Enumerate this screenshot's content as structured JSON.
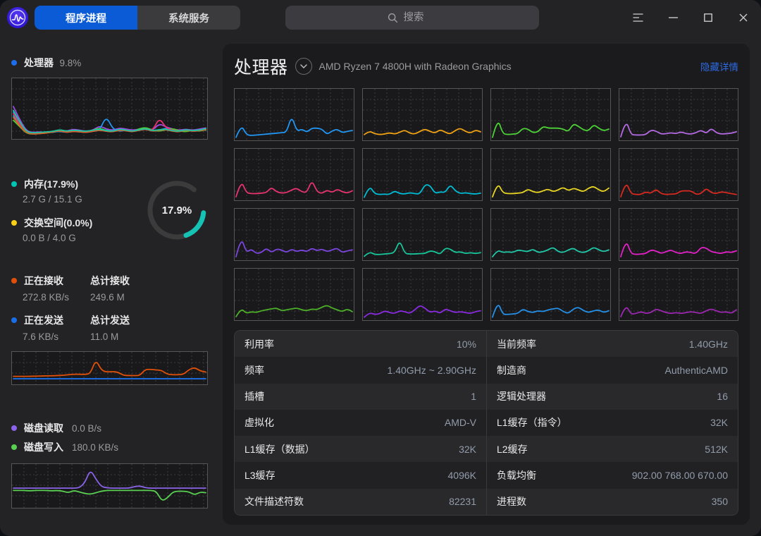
{
  "titlebar": {
    "tabs": [
      {
        "label": "程序进程",
        "active": true
      },
      {
        "label": "系统服务",
        "active": false
      }
    ],
    "search_placeholder": "搜索"
  },
  "colors": {
    "accent_blue": "#2e6be6",
    "active_tab": "#0b5bd7",
    "ring_used": "#16c2b4",
    "ring_track": "#3b3b3b"
  },
  "sidebar": {
    "cpu": {
      "label": "处理器",
      "value": "9.8%",
      "bullet": "#1e6eeb"
    },
    "memory": {
      "label": "内存(17.9%)",
      "value": "2.7 G / 15.1 G",
      "bullet": "#00c5b5"
    },
    "swap": {
      "label": "交换空间(0.0%)",
      "value": "0.0 B / 4.0 G",
      "bullet": "#f8d015"
    },
    "memory_ring": {
      "percent": 17.9,
      "label": "17.9%"
    },
    "net_recv": {
      "label": "正在接收",
      "value": "272.8 KB/s",
      "bullet": "#e0500a"
    },
    "net_recv_total": {
      "label": "总计接收",
      "value": "249.6 M"
    },
    "net_send": {
      "label": "正在发送",
      "value": "7.6 KB/s",
      "bullet": "#1a6ee8"
    },
    "net_send_total": {
      "label": "总计发送",
      "value": "11.0 M"
    },
    "disk_read": {
      "label": "磁盘读取",
      "value": "0.0 B/s",
      "bullet": "#8a64e8"
    },
    "disk_write": {
      "label": "磁盘写入",
      "value": "180.0 KB/s",
      "bullet": "#5ad052"
    }
  },
  "main": {
    "title": "处理器",
    "subtitle": "AMD Ryzen 7 4800H with Radeon Graphics",
    "toggle_link": "隐藏详情",
    "details_left": [
      {
        "label": "利用率",
        "value": "10%"
      },
      {
        "label": "频率",
        "value": "1.40GHz ~ 2.90GHz"
      },
      {
        "label": "插槽",
        "value": "1"
      },
      {
        "label": "虚拟化",
        "value": "AMD-V"
      },
      {
        "label": "L1缓存（数据）",
        "value": "32K"
      },
      {
        "label": "L3缓存",
        "value": "4096K"
      },
      {
        "label": "文件描述符数",
        "value": "82231"
      }
    ],
    "details_right": [
      {
        "label": "当前频率",
        "value": "1.40GHz"
      },
      {
        "label": "制造商",
        "value": "AuthenticAMD"
      },
      {
        "label": "逻辑处理器",
        "value": "16"
      },
      {
        "label": "L1缓存（指令）",
        "value": "32K"
      },
      {
        "label": "L2缓存",
        "value": "512K"
      },
      {
        "label": "负载均衡",
        "value": "902.00 768.00 670.00"
      },
      {
        "label": "进程数",
        "value": "350"
      }
    ]
  },
  "chart_data": {
    "type": "line",
    "cpu_overview": {
      "series": [
        {
          "color": "#9c4de0",
          "values": [
            55,
            30,
            10,
            8,
            9,
            8,
            10,
            12,
            10,
            14,
            12,
            10,
            12,
            20,
            14,
            12,
            16,
            14,
            12,
            14,
            16,
            12,
            24,
            18,
            14,
            12,
            14,
            12,
            14,
            16
          ]
        },
        {
          "color": "#2196f3",
          "values": [
            45,
            25,
            8,
            6,
            8,
            7,
            9,
            10,
            8,
            10,
            9,
            8,
            10,
            12,
            38,
            14,
            10,
            12,
            10,
            12,
            14,
            10,
            12,
            16,
            12,
            10,
            12,
            10,
            12,
            14
          ]
        },
        {
          "color": "#00bcd4",
          "values": [
            38,
            20,
            7,
            6,
            7,
            8,
            8,
            11,
            9,
            12,
            10,
            9,
            11,
            14,
            12,
            10,
            13,
            11,
            10,
            13,
            15,
            11,
            13,
            14,
            11,
            10,
            13,
            11,
            13,
            12
          ]
        },
        {
          "color": "#4cd137",
          "values": [
            30,
            18,
            6,
            5,
            6,
            7,
            9,
            13,
            10,
            11,
            9,
            8,
            12,
            16,
            11,
            9,
            14,
            12,
            9,
            15,
            17,
            12,
            10,
            13,
            15,
            11,
            9,
            12,
            10,
            13
          ]
        },
        {
          "color": "#e8d522, ",
          "values": [
            50,
            28,
            9,
            7,
            8,
            9,
            11,
            14,
            11,
            13,
            11,
            10,
            13,
            15,
            12,
            11,
            15,
            13,
            11,
            14,
            16,
            12,
            14,
            15,
            12,
            11,
            14,
            12,
            14,
            28
          ]
        },
        {
          "color": "#e8336e",
          "values": [
            42,
            22,
            8,
            6,
            7,
            8,
            10,
            12,
            9,
            11,
            10,
            9,
            11,
            13,
            11,
            10,
            13,
            12,
            10,
            13,
            15,
            11,
            35,
            16,
            12,
            10,
            13,
            11,
            12,
            14
          ]
        },
        {
          "color": "#e05a28",
          "values": [
            35,
            19,
            7,
            5,
            6,
            7,
            9,
            11,
            8,
            10,
            9,
            8,
            10,
            12,
            10,
            9,
            12,
            11,
            9,
            12,
            14,
            10,
            12,
            13,
            10,
            9,
            12,
            10,
            11,
            13
          ]
        },
        {
          "color": "#17c7a0",
          "values": [
            48,
            26,
            9,
            7,
            8,
            9,
            10,
            13,
            10,
            12,
            11,
            10,
            12,
            14,
            11,
            10,
            14,
            12,
            10,
            13,
            15,
            11,
            13,
            14,
            11,
            10,
            13,
            11,
            12,
            15
          ]
        }
      ]
    },
    "cores": [
      {
        "color": "#2196f3",
        "values": [
          2,
          30,
          8,
          6,
          7,
          8,
          9,
          10,
          11,
          12,
          13,
          50,
          15,
          20,
          13,
          22,
          22,
          20,
          8,
          16,
          20,
          12,
          15,
          17
        ]
      },
      {
        "color": "#efa213",
        "values": [
          8,
          16,
          10,
          8,
          9,
          12,
          9,
          13,
          18,
          11,
          9,
          15,
          20,
          15,
          11,
          19,
          13,
          9,
          17,
          22,
          15,
          11,
          18,
          14
        ]
      },
      {
        "color": "#4cd137",
        "values": [
          2,
          45,
          10,
          8,
          9,
          10,
          22,
          20,
          12,
          14,
          26,
          22,
          22,
          22,
          20,
          14,
          32,
          26,
          18,
          16,
          30,
          22,
          16,
          20
        ]
      },
      {
        "color": "#b36ae2",
        "values": [
          3,
          42,
          8,
          7,
          7,
          8,
          18,
          16,
          9,
          10,
          12,
          10,
          14,
          10,
          9,
          12,
          18,
          10,
          22,
          12,
          9,
          10,
          11,
          14
        ]
      },
      {
        "color": "#e8336e",
        "values": [
          3,
          40,
          12,
          10,
          10,
          11,
          12,
          24,
          14,
          11,
          12,
          18,
          22,
          14,
          12,
          40,
          14,
          10,
          18,
          12,
          20,
          14,
          11,
          16
        ]
      },
      {
        "color": "#00bcd4",
        "values": [
          2,
          28,
          10,
          8,
          9,
          8,
          16,
          10,
          9,
          12,
          10,
          9,
          30,
          28,
          10,
          14,
          12,
          30,
          16,
          10,
          12,
          10,
          9,
          11
        ]
      },
      {
        "color": "#e8d522",
        "values": [
          3,
          35,
          12,
          10,
          10,
          11,
          12,
          20,
          14,
          12,
          16,
          20,
          14,
          18,
          24,
          16,
          22,
          18,
          14,
          22,
          26,
          18,
          14,
          22
        ]
      },
      {
        "color": "#d62a20",
        "values": [
          3,
          38,
          10,
          8,
          8,
          14,
          10,
          20,
          10,
          8,
          9,
          9,
          16,
          16,
          16,
          8,
          10,
          22,
          12,
          10,
          14,
          12,
          10,
          8
        ]
      },
      {
        "color": "#7b45e0",
        "values": [
          3,
          48,
          12,
          20,
          10,
          12,
          22,
          12,
          20,
          18,
          12,
          20,
          14,
          18,
          14,
          22,
          16,
          20,
          14,
          18,
          22,
          12,
          16,
          18
        ]
      },
      {
        "color": "#17c79a",
        "values": [
          4,
          14,
          8,
          8,
          9,
          10,
          12,
          40,
          10,
          9,
          9,
          10,
          10,
          16,
          14,
          8,
          22,
          20,
          12,
          14,
          10,
          12,
          10,
          12
        ]
      },
      {
        "color": "#1fc9a8",
        "values": [
          3,
          18,
          12,
          14,
          12,
          18,
          16,
          14,
          20,
          12,
          14,
          18,
          24,
          14,
          12,
          18,
          22,
          14,
          12,
          16,
          24,
          18,
          14,
          18
        ]
      },
      {
        "color": "#e321c9",
        "values": [
          3,
          42,
          10,
          8,
          9,
          10,
          18,
          16,
          10,
          14,
          18,
          12,
          10,
          14,
          12,
          10,
          24,
          22,
          14,
          12,
          10,
          14,
          12,
          16
        ]
      },
      {
        "color": "#4caf28",
        "values": [
          3,
          22,
          10,
          14,
          12,
          16,
          18,
          20,
          22,
          16,
          18,
          20,
          22,
          18,
          16,
          20,
          18,
          24,
          28,
          22,
          18,
          14,
          20,
          14
        ]
      },
      {
        "color": "#8a2be2",
        "values": [
          2,
          12,
          8,
          9,
          16,
          12,
          10,
          16,
          14,
          10,
          18,
          28,
          22,
          12,
          16,
          10,
          20,
          16,
          12,
          14,
          12,
          10,
          14,
          16
        ]
      },
      {
        "color": "#2590e8",
        "values": [
          2,
          38,
          8,
          8,
          9,
          10,
          20,
          14,
          12,
          16,
          14,
          18,
          20,
          22,
          14,
          10,
          20,
          24,
          16,
          12,
          16,
          18,
          12,
          16
        ]
      },
      {
        "color": "#9c27b0",
        "values": [
          3,
          30,
          8,
          10,
          14,
          10,
          12,
          20,
          16,
          12,
          10,
          12,
          10,
          12,
          14,
          12,
          10,
          16,
          20,
          16,
          12,
          14,
          10,
          18
        ]
      }
    ],
    "network": {
      "series": [
        {
          "name": "接收",
          "color": "#e0500a",
          "values": [
            22,
            22,
            22,
            22,
            23,
            23,
            24,
            24,
            25,
            26,
            28,
            30,
            30,
            29,
            32,
            85,
            45,
            38,
            40,
            38,
            26,
            25,
            25,
            25,
            48,
            48,
            46,
            44,
            30,
            28,
            28,
            30,
            48,
            55,
            42,
            38
          ]
        },
        {
          "name": "发送",
          "color": "#1a6ee8",
          "values": [
            13,
            13
          ]
        }
      ]
    },
    "disk": {
      "series": [
        {
          "name": "读取",
          "color": "#8a64e8",
          "values": [
            46,
            46,
            46,
            46,
            46,
            46,
            46,
            46,
            46,
            46,
            46,
            46,
            47,
            60,
            95,
            70,
            50,
            47,
            46,
            46,
            46,
            46,
            50,
            52,
            47,
            46,
            46,
            46,
            46,
            46,
            46,
            46,
            46,
            46,
            46,
            46
          ]
        },
        {
          "name": "写入",
          "color": "#5ad052",
          "values": [
            40,
            40,
            40,
            39,
            40,
            40,
            40,
            39,
            40,
            38,
            34,
            40,
            36,
            32,
            30,
            34,
            38,
            40,
            40,
            40,
            40,
            40,
            40,
            40,
            40,
            40,
            38,
            12,
            20,
            36,
            38,
            38,
            36,
            28,
            36,
            34
          ]
        }
      ]
    },
    "memory_ring": {
      "percent": 17.9
    }
  }
}
